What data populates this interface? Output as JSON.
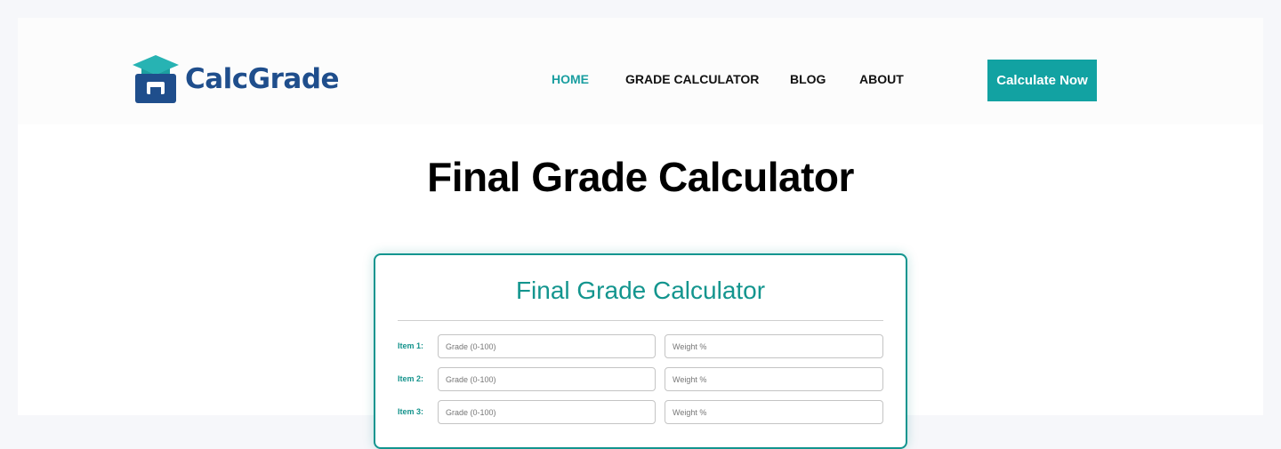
{
  "brand": {
    "name": "CalcGrade",
    "primary_color": "#1f4e8c",
    "accent_color": "#12a2a2",
    "logo_icon": "graduation-box-icon"
  },
  "nav": {
    "items": [
      {
        "label": "HOME",
        "active": true
      },
      {
        "label": "GRADE CALCULATOR",
        "active": false
      },
      {
        "label": "BLOG",
        "active": false
      },
      {
        "label": "ABOUT",
        "active": false
      }
    ],
    "cta_label": "Calculate Now"
  },
  "page": {
    "title": "Final Grade Calculator"
  },
  "calculator": {
    "title": "Final Grade Calculator",
    "items": [
      {
        "label": "Item 1:",
        "grade_placeholder": "Grade (0-100)",
        "weight_placeholder": "Weight %"
      },
      {
        "label": "Item 2:",
        "grade_placeholder": "Grade (0-100)",
        "weight_placeholder": "Weight %"
      },
      {
        "label": "Item 3:",
        "grade_placeholder": "Grade (0-100)",
        "weight_placeholder": "Weight %"
      }
    ]
  }
}
